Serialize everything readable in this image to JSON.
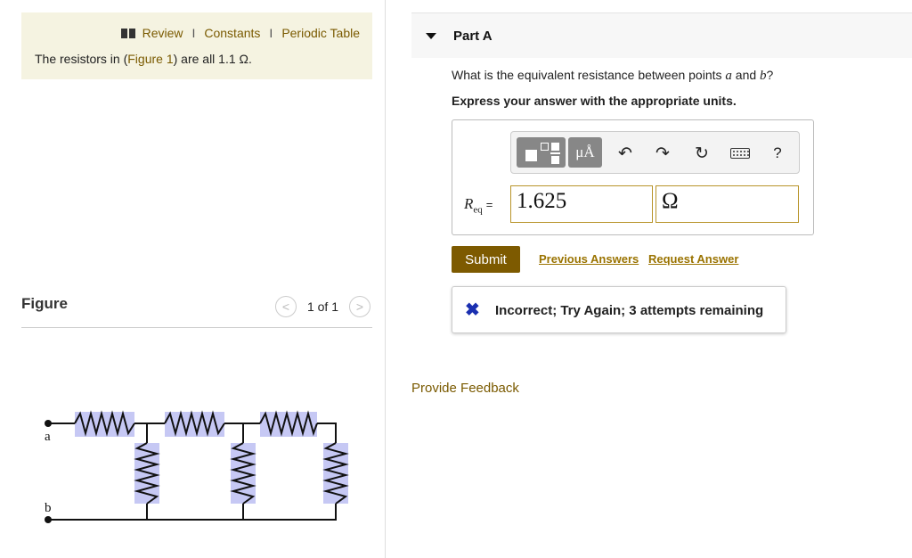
{
  "header_links": {
    "review": "Review",
    "separator": "I",
    "constants": "Constants",
    "periodic_table": "Periodic Table"
  },
  "statement": {
    "before": "The resistors in (",
    "figure_link": "Figure 1",
    "after": ") are all 1.1 Ω."
  },
  "figure": {
    "title": "Figure",
    "page": "1 of 1",
    "prev_symbol": "<",
    "next_symbol": ">",
    "label_a": "a",
    "label_b": "b"
  },
  "part": {
    "title": "Part A",
    "question_before": "What is the equivalent resistance between points ",
    "point_a": "a",
    "question_mid": " and ",
    "point_b": "b",
    "question_after": "?",
    "instruction": "Express your answer with the appropriate units."
  },
  "toolbar": {
    "units_label": "μÅ",
    "undo_symbol": "↶",
    "redo_symbol": "↷",
    "reset_symbol": "↻",
    "help_symbol": "?",
    "icons": [
      "templates-icon",
      "units-icon",
      "undo-icon",
      "redo-icon",
      "reset-icon",
      "keyboard-icon",
      "help-icon"
    ]
  },
  "answer": {
    "label_main": "R",
    "label_sub": "eq",
    "label_eq": "=",
    "value": "1.625",
    "unit": "Ω"
  },
  "actions": {
    "submit": "Submit",
    "previous_answers": "Previous Answers",
    "request_answer": "Request Answer"
  },
  "feedback": {
    "icon": "✖",
    "message": "Incorrect; Try Again; 3 attempts remaining"
  },
  "provide_feedback": "Provide Feedback",
  "colors": {
    "accent_brown": "#7d5a00",
    "link_gold": "#9a7300",
    "info_bg": "#f5f3e1",
    "resistor_fill": "#c6c8f4",
    "error_blue": "#1a2fb0"
  }
}
